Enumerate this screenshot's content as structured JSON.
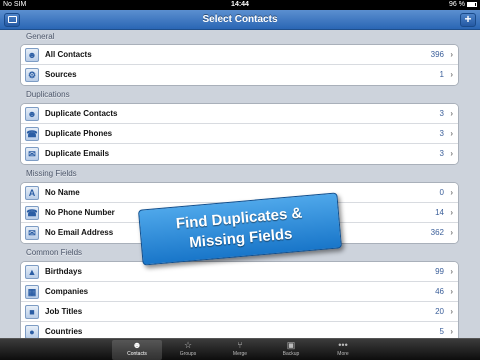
{
  "status": {
    "carrier": "No SIM",
    "time": "14:44",
    "battery": "96 %"
  },
  "nav": {
    "title": "Select Contacts",
    "right_button": "+"
  },
  "sections": {
    "general": {
      "title": "General",
      "rows": [
        {
          "label": "All Contacts",
          "count": "396",
          "icon": "contacts-icon"
        },
        {
          "label": "Sources",
          "count": "1",
          "icon": "sources-icon"
        }
      ]
    },
    "duplications": {
      "title": "Duplications",
      "rows": [
        {
          "label": "Duplicate Contacts",
          "count": "3",
          "icon": "duplicate-contacts-icon"
        },
        {
          "label": "Duplicate Phones",
          "count": "3",
          "icon": "phone-icon"
        },
        {
          "label": "Duplicate Emails",
          "count": "3",
          "icon": "email-icon"
        }
      ]
    },
    "missing": {
      "title": "Missing Fields",
      "rows": [
        {
          "label": "No Name",
          "count": "0",
          "icon": "no-name-icon"
        },
        {
          "label": "No Phone Number",
          "count": "14",
          "icon": "no-phone-icon"
        },
        {
          "label": "No Email Address",
          "count": "362",
          "icon": "no-email-icon"
        }
      ]
    },
    "common": {
      "title": "Common Fields",
      "rows": [
        {
          "label": "Birthdays",
          "count": "99",
          "icon": "birthday-icon"
        },
        {
          "label": "Companies",
          "count": "46",
          "icon": "company-icon"
        },
        {
          "label": "Job Titles",
          "count": "20",
          "icon": "job-icon"
        },
        {
          "label": "Countries",
          "count": "5",
          "icon": "globe-icon"
        }
      ]
    }
  },
  "banner": {
    "line1": "Find Duplicates &",
    "line2": "Missing Fields"
  },
  "tabs": [
    {
      "label": "Contacts",
      "icon": "contacts-tab-icon",
      "glyph": "☻"
    },
    {
      "label": "Groups",
      "icon": "star-icon",
      "glyph": "☆"
    },
    {
      "label": "Merge",
      "icon": "merge-icon",
      "glyph": "⑂"
    },
    {
      "label": "Backup",
      "icon": "backup-icon",
      "glyph": "▣"
    },
    {
      "label": "More",
      "icon": "more-icon",
      "glyph": "•••"
    }
  ]
}
